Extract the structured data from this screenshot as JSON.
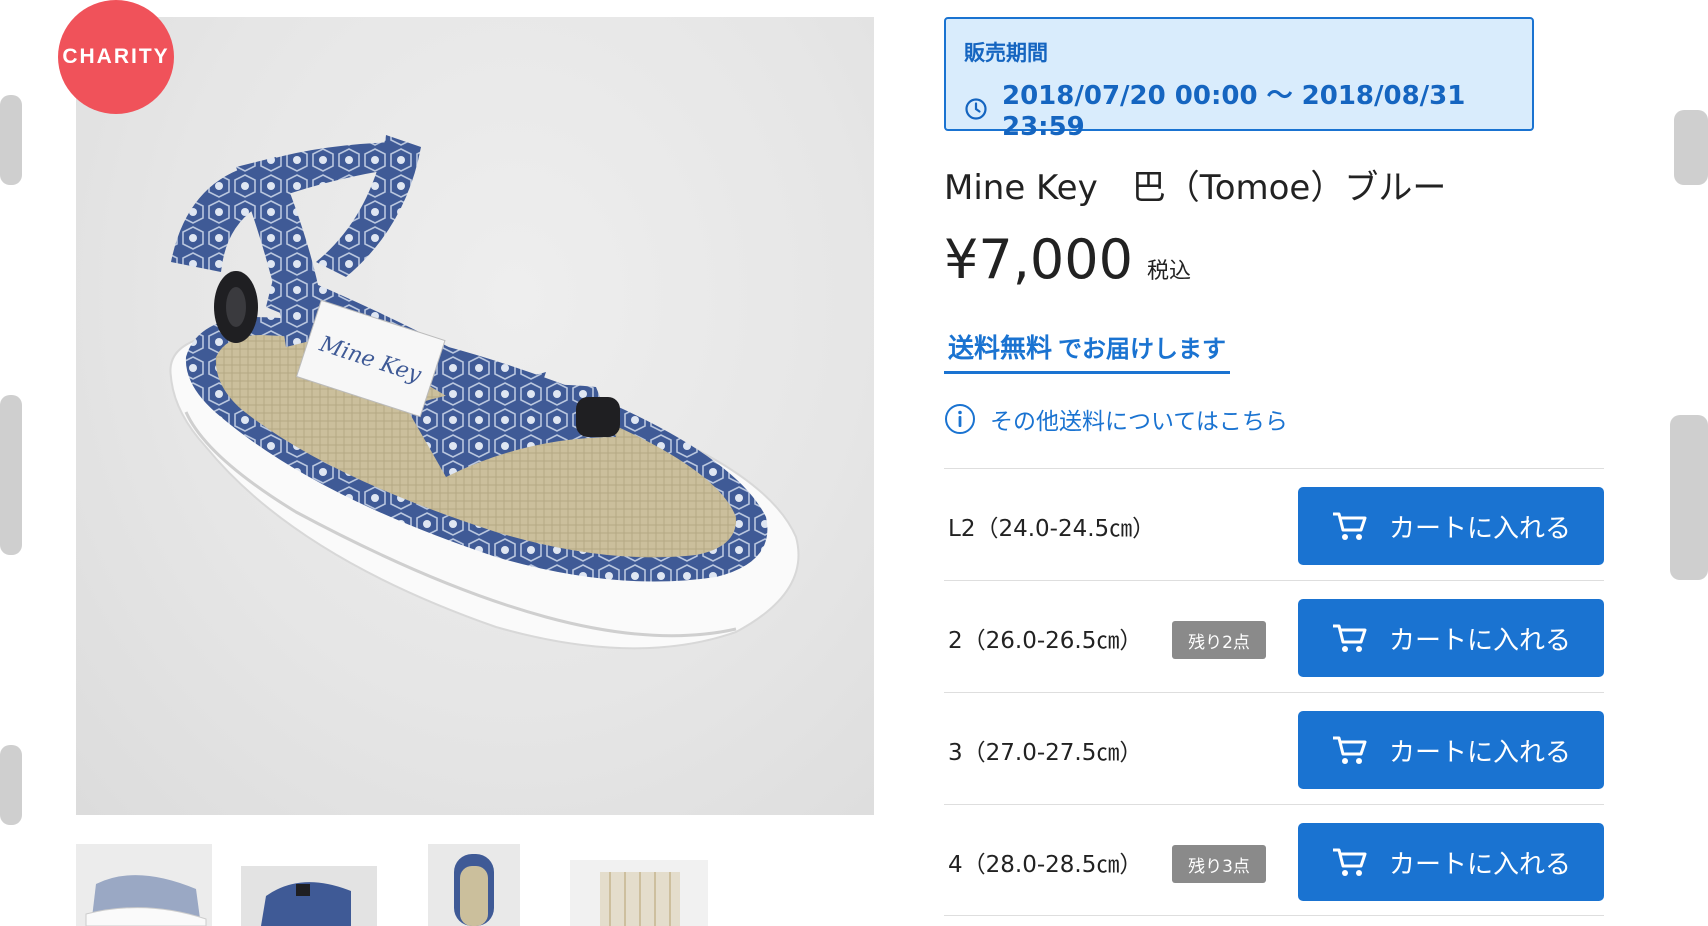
{
  "badge": {
    "text": "CHARITY",
    "color": "#f0525a"
  },
  "sales_period": {
    "label": "販売期間",
    "range": "2018/07/20 00:00 〜 2018/08/31 23:59",
    "icon": "clock-icon"
  },
  "product": {
    "title": "Mine Key　巴（Tomoe）ブルー",
    "price": "¥7,000",
    "tax_note": "税込"
  },
  "shipping": {
    "free_strong": "送料無料",
    "free_rest": "でお届けします",
    "other_link": "その他送料についてはこちら",
    "other_icon": "info-icon"
  },
  "sizes": [
    {
      "label": "L2（24.0-24.5㎝）",
      "stock": "",
      "button": "カートに入れる"
    },
    {
      "label": "2（26.0-26.5㎝）",
      "stock": "残り2点",
      "button": "カートに入れる"
    },
    {
      "label": "3（27.0-27.5㎝）",
      "stock": "",
      "button": "カートに入れる"
    },
    {
      "label": "4（28.0-28.5㎝）",
      "stock": "残り3点",
      "button": "カートに入れる"
    }
  ],
  "colors": {
    "accent": "#1a73d1",
    "period_bg": "#d9ecfc",
    "stock_badge": "#8a8a8a"
  },
  "main_image": {
    "logo_text": "Mine Key"
  }
}
